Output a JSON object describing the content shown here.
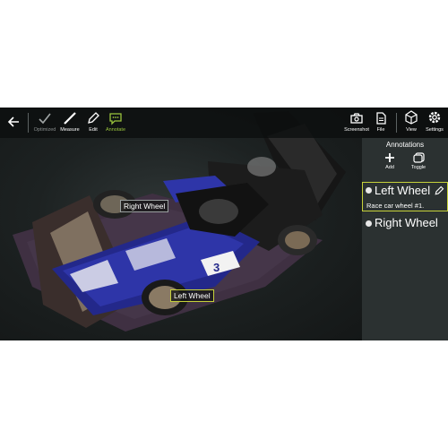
{
  "toolbar": {
    "back_icon": "back-arrow-icon",
    "tools": [
      {
        "label": "Optimized",
        "icon": "check-icon",
        "state": "disabled"
      },
      {
        "label": "Measure",
        "icon": "ruler-icon"
      },
      {
        "label": "Edit",
        "icon": "pencil-icon"
      },
      {
        "label": "Annotate",
        "icon": "comment-icon",
        "state": "active"
      }
    ],
    "right_tools": [
      {
        "label": "Screenshot",
        "icon": "camera-icon"
      },
      {
        "label": "File",
        "icon": "file-icon"
      },
      {
        "label": "View",
        "icon": "cube-icon"
      },
      {
        "label": "Settings",
        "icon": "gear-icon"
      }
    ]
  },
  "panel": {
    "title": "Annotations",
    "add_label": "Add",
    "toggle_label": "Toggle",
    "annotations": [
      {
        "title": "Left Wheel",
        "description": "Race car wheel #1.",
        "selected": true
      },
      {
        "title": "Right Wheel",
        "description": "",
        "selected": false
      }
    ]
  },
  "scene": {
    "car_number": "3",
    "labels": [
      {
        "text": "Right Wheel"
      },
      {
        "text": "Left Wheel"
      }
    ]
  },
  "colors": {
    "accent_green": "#9bc53d",
    "selection_border": "#c6d13a",
    "panel_bg": "#2b3131",
    "toolbar_bg": "#0c0e0e",
    "car_blue": "#23288a"
  }
}
